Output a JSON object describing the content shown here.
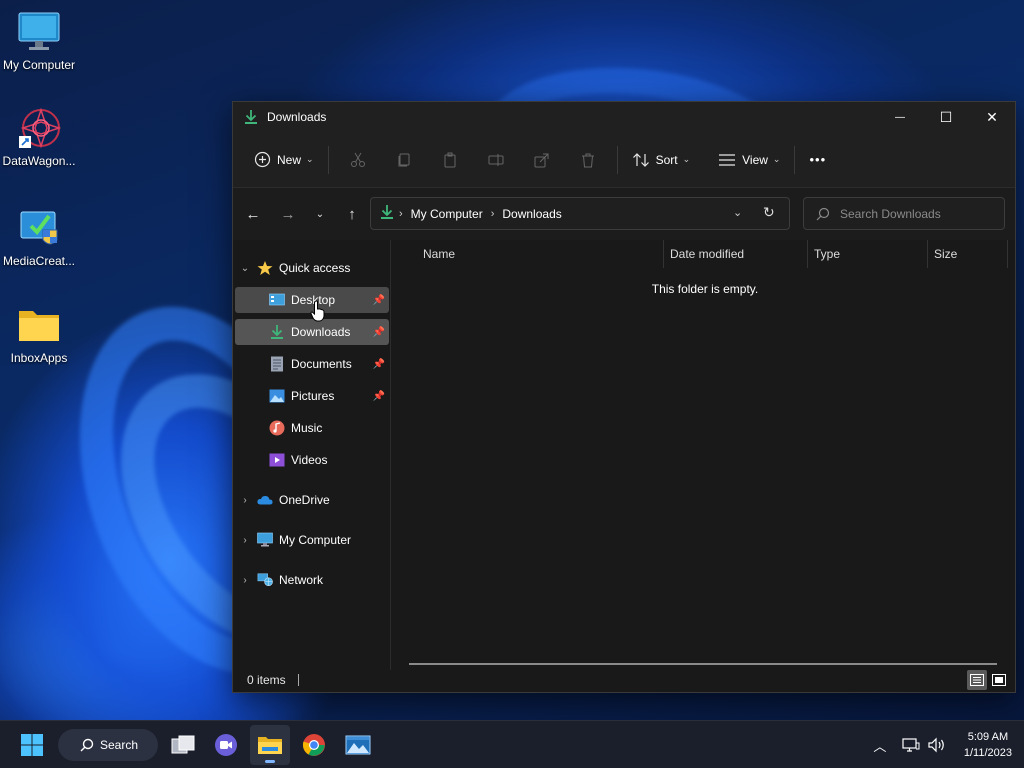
{
  "desktop": {
    "icons": [
      {
        "label": "My Computer"
      },
      {
        "label": "DataWagon..."
      },
      {
        "label": "MediaCreat..."
      },
      {
        "label": "InboxApps"
      }
    ]
  },
  "window": {
    "title": "Downloads",
    "controls": {
      "minimize": "—",
      "maximize": "☐",
      "close": "✕"
    }
  },
  "toolbar": {
    "new_label": "New",
    "sort_label": "Sort",
    "view_label": "View",
    "more_label": "•••"
  },
  "nav": {
    "breadcrumb": [
      "My Computer",
      "Downloads"
    ],
    "search_placeholder": "Search Downloads"
  },
  "sidebar": {
    "quick_access": "Quick access",
    "pinned": [
      {
        "label": "Desktop"
      },
      {
        "label": "Downloads"
      },
      {
        "label": "Documents"
      },
      {
        "label": "Pictures"
      },
      {
        "label": "Music"
      },
      {
        "label": "Videos"
      }
    ],
    "roots": [
      {
        "label": "OneDrive"
      },
      {
        "label": "My Computer"
      },
      {
        "label": "Network"
      }
    ]
  },
  "content": {
    "columns": [
      "Name",
      "Date modified",
      "Type",
      "Size"
    ],
    "empty_message": "This folder is empty."
  },
  "status": {
    "items": "0 items"
  },
  "taskbar": {
    "search_label": "Search",
    "time": "5:09 AM",
    "date": "1/11/2023"
  },
  "colors": {
    "accent": "#4cc2ff",
    "download_green": "#3fb67a",
    "folder_yellow": "#f4c430"
  }
}
